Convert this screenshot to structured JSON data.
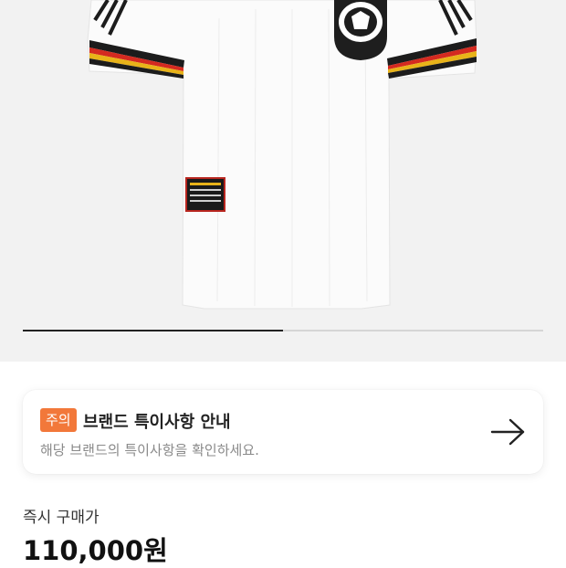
{
  "product": {
    "image_alt": "product-jersey-image",
    "gallery_progress": 0.5
  },
  "notice": {
    "badge": "주의",
    "title": "브랜드 특이사항 안내",
    "description": "해당 브랜드의 특이사항을 확인하세요.",
    "arrow_icon": "arrow-right-icon"
  },
  "price": {
    "label": "즉시 구매가",
    "value": "110,000원"
  },
  "colors": {
    "badge": "#f2783a",
    "hero_background": "#f2f2f2",
    "progress_active": "#222222",
    "progress_track": "#d6d6d6"
  }
}
